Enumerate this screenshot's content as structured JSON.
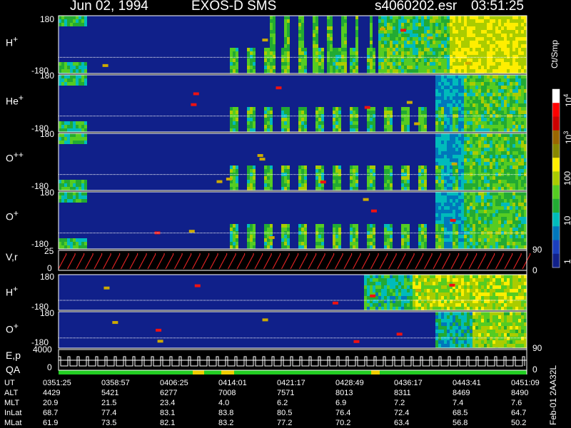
{
  "header": {
    "date": "Jun 02, 1994",
    "instrument": "EXOS-D SMS",
    "filename": "s4060202.esr",
    "time": "03:51:25"
  },
  "colorbar": {
    "unit": "Ct/Smp",
    "ticks": [
      "10",
      "10",
      "100",
      "10",
      "1"
    ],
    "tick_exponents": [
      "4",
      "3"
    ],
    "colors": [
      "#ffffff",
      "#ff0000",
      "#cc0000",
      "#996600",
      "#888800",
      "#ffee00",
      "#aacc00",
      "#55cc22",
      "#22aa33",
      "#00bbbb",
      "#0077bb",
      "#1a3fbe",
      "#10208a"
    ]
  },
  "panels": [
    {
      "species": "H",
      "sup": "+",
      "top": "180",
      "bottom": "-180"
    },
    {
      "species": "He",
      "sup": "+",
      "top": "180",
      "bottom": "-180"
    },
    {
      "species": "O",
      "sup": "++",
      "top": "180",
      "bottom": "-180"
    },
    {
      "species": "O",
      "sup": "+",
      "top": "180",
      "bottom": "-180"
    },
    {
      "species": "V,r",
      "sup": "",
      "top": "25",
      "bottom": "0",
      "right": "90",
      "right2": "0"
    },
    {
      "species": "H",
      "sup": "+",
      "top": "180",
      "bottom": "-180"
    },
    {
      "species": "O",
      "sup": "+",
      "top": "180",
      "bottom": "-180",
      "right": "90"
    },
    {
      "species": "E,p",
      "sup": "",
      "top": "4000",
      "bottom": "0",
      "right": "0"
    }
  ],
  "qa_label": "QA",
  "side_label": "Feb-01 2AA32L",
  "chart_data": {
    "type": "heatmap",
    "title": "Jun 02, 1994   EXOS-D SMS",
    "colorbar_label": "Ct/Smp",
    "colorbar_range": [
      1,
      10000
    ],
    "colorbar_scale": "log",
    "x_ticks_ut": [
      "0351:25",
      "0358:57",
      "0406:25",
      "0414:01",
      "0421:17",
      "0428:49",
      "0436:17",
      "0443:41",
      "0451:09"
    ],
    "y_range_pitch_angle": [
      -180,
      180
    ],
    "vr_range": [
      0,
      25
    ],
    "ep_range": [
      0,
      4000
    ],
    "ephemeris": {
      "UT": [
        "0351:25",
        "0358:57",
        "0406:25",
        "0414:01",
        "0421:17",
        "0428:49",
        "0436:17",
        "0443:41",
        "0451:09"
      ],
      "ALT": [
        "4429",
        "5421",
        "6277",
        "7008",
        "7571",
        "8013",
        "8311",
        "8469",
        "8490"
      ],
      "MLT": [
        "20.9",
        "21.5",
        "23.4",
        "4.0",
        "6.2",
        "6.9",
        "7.2",
        "7.4",
        "7.6"
      ],
      "InLat": [
        "68.7",
        "77.4",
        "83.1",
        "83.8",
        "80.5",
        "76.4",
        "72.4",
        "68.5",
        "64.7"
      ],
      "MLat": [
        "61.9",
        "73.5",
        "82.1",
        "83.2",
        "77.2",
        "70.2",
        "63.4",
        "56.8",
        "50.2"
      ]
    }
  }
}
